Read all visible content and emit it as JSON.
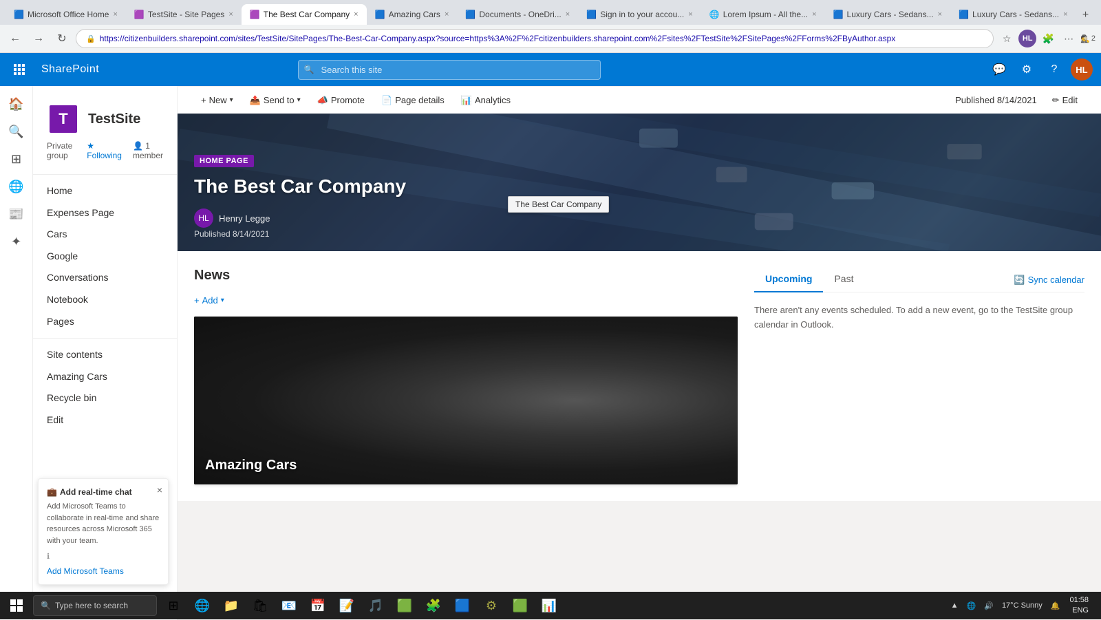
{
  "browser": {
    "tabs": [
      {
        "id": "t1",
        "label": "Microsoft Office Home",
        "active": false,
        "favicon": "🟦"
      },
      {
        "id": "t2",
        "label": "TestSite - Site Pages",
        "active": false,
        "favicon": "🟪"
      },
      {
        "id": "t3",
        "label": "The Best Car Company",
        "active": true,
        "favicon": "🟪"
      },
      {
        "id": "t4",
        "label": "Amazing Cars",
        "active": false,
        "favicon": "🟦"
      },
      {
        "id": "t5",
        "label": "Documents - OneDri...",
        "active": false,
        "favicon": "🟦"
      },
      {
        "id": "t6",
        "label": "Sign in to your accou...",
        "active": false,
        "favicon": "🟦"
      },
      {
        "id": "t7",
        "label": "Lorem Ipsum - All the...",
        "active": false,
        "favicon": "🌐"
      },
      {
        "id": "t8",
        "label": "Luxury Cars - Sedans...",
        "active": false,
        "favicon": "🟦"
      },
      {
        "id": "t9",
        "label": "Luxury Cars - Sedans...",
        "active": false,
        "favicon": "🟦"
      }
    ],
    "address": "https://citizenbuilders.sharepoint.com/sites/TestSite/SitePages/The-Best-Car-Company.aspx?source=https%3A%2F%2Fcitizenbuilders.sharepoint.com%2Fsites%2FTestSite%2FSitePages%2FForms%2FByAuthor.aspx",
    "incognito_count": 2
  },
  "sharepoint": {
    "header": {
      "app_name": "SharePoint",
      "search_placeholder": "Search this site",
      "site": {
        "icon_letter": "T",
        "title": "TestSite"
      },
      "meta": {
        "group_label": "Private group",
        "following_label": "Following",
        "members_label": "1 member"
      }
    },
    "action_bar": {
      "new_label": "New",
      "send_to_label": "Send to",
      "promote_label": "Promote",
      "page_details_label": "Page details",
      "analytics_label": "Analytics",
      "published_label": "Published 8/14/2021",
      "edit_label": "Edit"
    },
    "nav": {
      "items": [
        {
          "label": "Home"
        },
        {
          "label": "Expenses Page"
        },
        {
          "label": "Cars"
        },
        {
          "label": "Google"
        },
        {
          "label": "Conversations"
        },
        {
          "label": "Notebook"
        },
        {
          "label": "Pages"
        },
        {
          "label": "Site contents"
        },
        {
          "label": "Amazing Cars"
        },
        {
          "label": "Recycle bin"
        },
        {
          "label": "Edit"
        }
      ]
    },
    "hero": {
      "tag": "HOME PAGE",
      "title": "The Best Car Company",
      "author": "Henry Legge",
      "published": "Published 8/14/2021",
      "tooltip": "The Best Car Company"
    },
    "news": {
      "title": "News",
      "add_label": "Add",
      "card": {
        "title": "Amazing Cars"
      }
    },
    "events": {
      "tabs": [
        {
          "label": "Upcoming",
          "active": true
        },
        {
          "label": "Past",
          "active": false
        }
      ],
      "sync_label": "Sync calendar",
      "empty_message": "There aren't any events scheduled. To add a new event, go to the TestSite group calendar in Outlook."
    },
    "chat_panel": {
      "title": "Add real-time chat",
      "body": "Add Microsoft Teams to collaborate in real-time and share resources across Microsoft 365 with your team.",
      "info_label": "",
      "add_label": "Add Microsoft Teams"
    }
  },
  "taskbar": {
    "search_placeholder": "Type here to search",
    "weather": "17°C  Sunny",
    "time": "ENG"
  }
}
